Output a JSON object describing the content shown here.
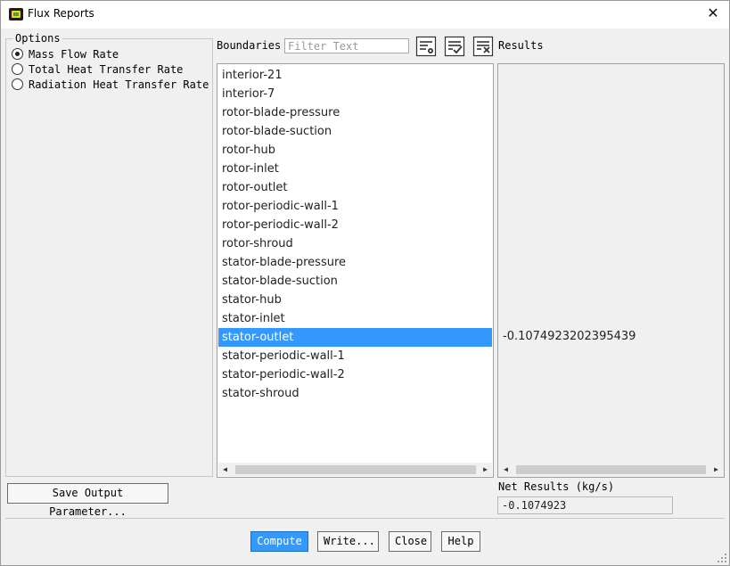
{
  "window": {
    "title": "Flux Reports"
  },
  "options": {
    "legend": "Options",
    "items": [
      {
        "label": "Mass Flow Rate",
        "checked": true
      },
      {
        "label": "Total Heat Transfer Rate",
        "checked": false
      },
      {
        "label": "Radiation Heat Transfer Rate",
        "checked": false
      }
    ]
  },
  "boundaries": {
    "label": "Boundaries",
    "filter_placeholder": "Filter Text",
    "items": [
      "interior-21",
      "interior-7",
      "rotor-blade-pressure",
      "rotor-blade-suction",
      "rotor-hub",
      "rotor-inlet",
      "rotor-outlet",
      "rotor-periodic-wall-1",
      "rotor-periodic-wall-2",
      "rotor-shroud",
      "stator-blade-pressure",
      "stator-blade-suction",
      "stator-hub",
      "stator-inlet",
      "stator-outlet",
      "stator-periodic-wall-1",
      "stator-periodic-wall-2",
      "stator-shroud"
    ],
    "selected_index": 14
  },
  "results": {
    "label": "Results",
    "value": "-0.1074923202395439"
  },
  "net_results": {
    "label": "Net Results (kg/s)",
    "value": "-0.1074923"
  },
  "buttons": {
    "save_output": "Save Output Parameter...",
    "compute": "Compute",
    "write": "Write...",
    "close": "Close",
    "help": "Help"
  },
  "colors": {
    "selection": "#3399ff",
    "window_bg": "#f0f0f0"
  }
}
